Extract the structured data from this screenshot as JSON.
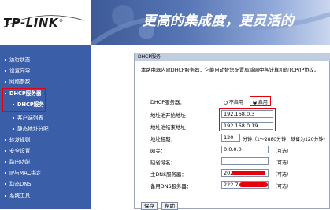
{
  "header": {
    "logo": "TP-LINK",
    "logo_mark": "®",
    "slogan": "更高的集成度，更灵活的"
  },
  "sidebar": {
    "items": [
      {
        "label": "运行状态"
      },
      {
        "label": "设置向导"
      },
      {
        "label": "网络参数"
      },
      {
        "label": "DHCP服务器"
      },
      {
        "label": "DHCP服务"
      },
      {
        "label": "客户端列表"
      },
      {
        "label": "静态地址分配"
      },
      {
        "label": "转发规则"
      },
      {
        "label": "安全设置"
      },
      {
        "label": "路由功能"
      },
      {
        "label": "IP与MAC绑定"
      },
      {
        "label": "动态DNS"
      },
      {
        "label": "系统工具"
      }
    ]
  },
  "panel": {
    "title": "DHCP服务",
    "description": "本路由器内建DHCP服务器，它能自动替您配置局域网中各计算机的TCP/IP协议。",
    "dhcp_server_label": "DHCP服务器：",
    "dhcp_options": [
      "不启用",
      "启用"
    ],
    "dhcp_selected": "启用",
    "start_label": "地址池开始地址：",
    "start_value": "192.168.0.3",
    "end_label": "地址池结束地址：",
    "end_value": "192.168.0.19",
    "lease_label": "地址租期：",
    "lease_value": "120",
    "lease_note": "分钟（1～2880分钟，缺省为120分钟）",
    "gateway_label": "网关：",
    "gateway_value": "0.0.0.0",
    "optional": "（可选）",
    "domain_label": "缺省域名：",
    "domain_value": "",
    "dns1_label": "主DNS服务器：",
    "dns1_value": "202",
    "dns2_label": "备用DNS服务器：",
    "dns2_value": "222.7",
    "save_label": "保存",
    "help_label": "帮助"
  }
}
